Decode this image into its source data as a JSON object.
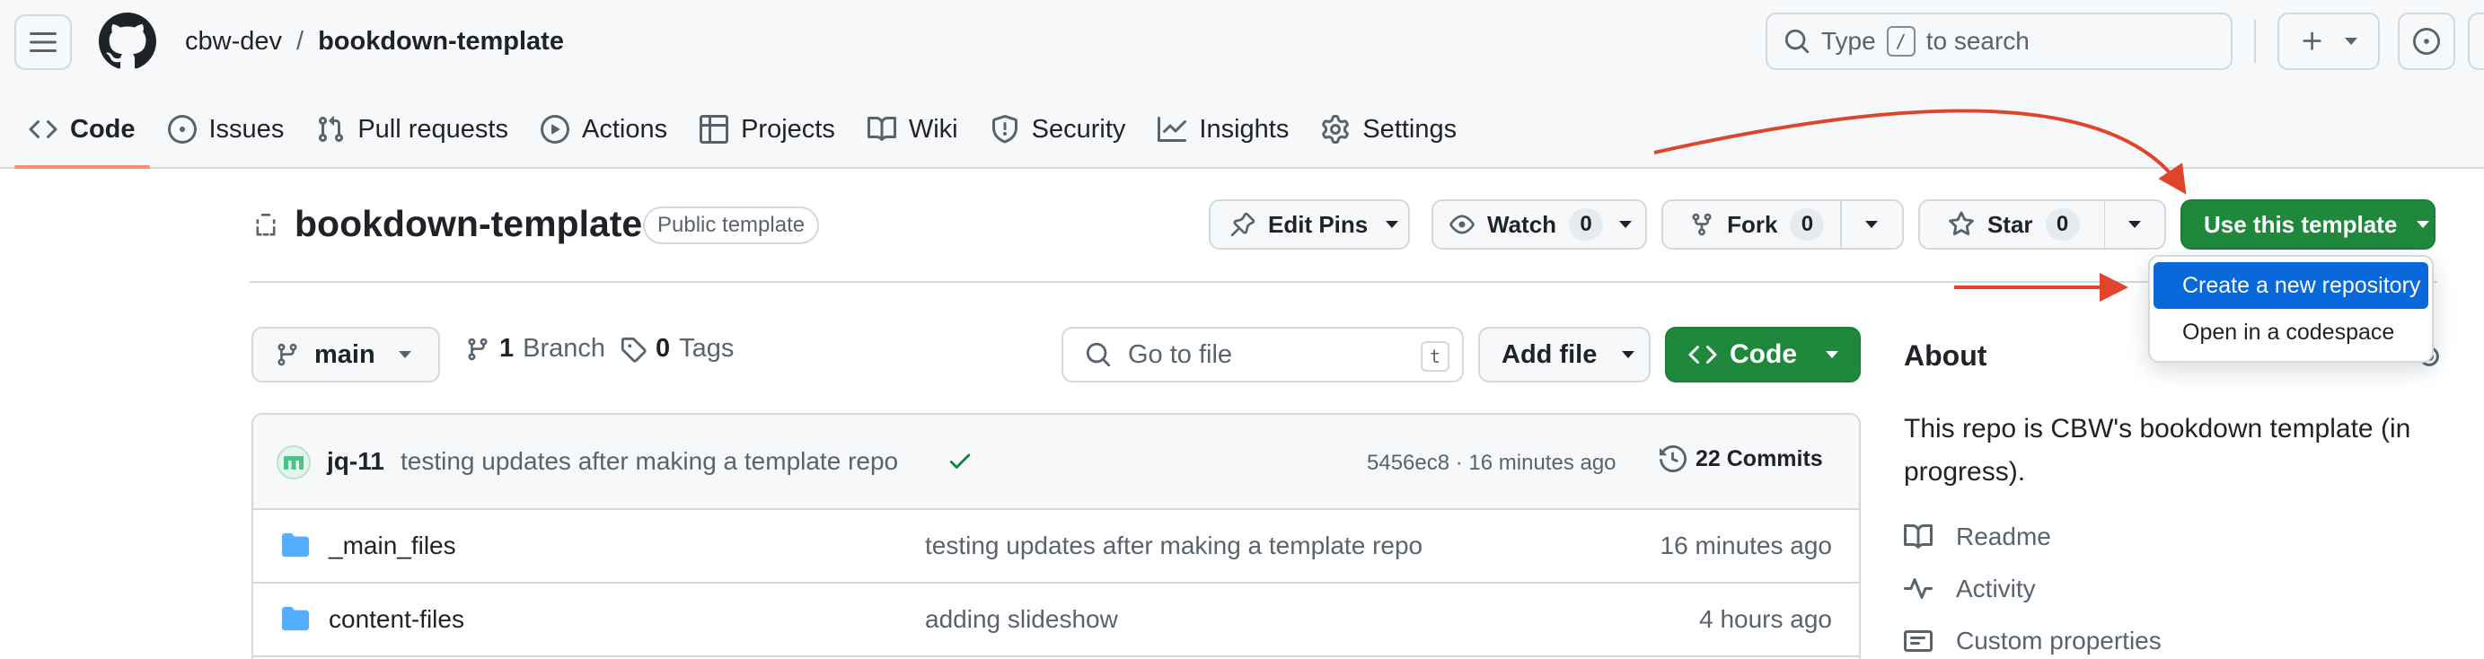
{
  "header": {
    "owner": "cbw-dev",
    "separator": "/",
    "repo": "bookdown-template",
    "search_prefix": "Type",
    "search_key": "/",
    "search_suffix": "to search"
  },
  "tabs": [
    {
      "label": "Code",
      "icon": "code-icon",
      "selected": true
    },
    {
      "label": "Issues",
      "icon": "issue-icon"
    },
    {
      "label": "Pull requests",
      "icon": "pull-request-icon"
    },
    {
      "label": "Actions",
      "icon": "play-icon"
    },
    {
      "label": "Projects",
      "icon": "table-icon"
    },
    {
      "label": "Wiki",
      "icon": "book-icon"
    },
    {
      "label": "Security",
      "icon": "shield-icon"
    },
    {
      "label": "Insights",
      "icon": "graph-icon"
    },
    {
      "label": "Settings",
      "icon": "gear-icon"
    }
  ],
  "repo_header": {
    "title": "bookdown-template",
    "badge": "Public template",
    "edit_pins": "Edit Pins",
    "watch": "Watch",
    "watch_count": "0",
    "fork": "Fork",
    "fork_count": "0",
    "star": "Star",
    "star_count": "0",
    "use_template": "Use this template"
  },
  "template_menu": {
    "items": [
      "Create a new repository",
      "Open in a codespace"
    ],
    "active_index": 0
  },
  "file_nav": {
    "branch": "main",
    "branch_count": "1",
    "branch_label": "Branch",
    "tag_count": "0",
    "tag_label": "Tags",
    "goto_placeholder": "Go to file",
    "goto_key": "t",
    "add_file": "Add file",
    "code": "Code"
  },
  "latest_commit": {
    "author": "jq-11",
    "message": "testing updates after making a template repo",
    "sha_time": "5456ec8 · 16 minutes ago",
    "commits": "22 Commits"
  },
  "files": [
    {
      "name": "_main_files",
      "message": "testing updates after making a template repo",
      "time": "16 minutes ago"
    },
    {
      "name": "content-files",
      "message": "adding slideshow",
      "time": "4 hours ago"
    }
  ],
  "about": {
    "title": "About",
    "description": "This repo is CBW's bookdown template (in progress).",
    "links": [
      {
        "label": "Readme",
        "icon": "book-icon"
      },
      {
        "label": "Activity",
        "icon": "pulse-icon"
      },
      {
        "label": "Custom properties",
        "icon": "note-icon"
      }
    ]
  },
  "colors": {
    "accent_green": "#1f883d",
    "menu_highlight": "#0969da",
    "annotation_arrow": "#e0442a",
    "tab_underline": "#fd8c73"
  }
}
